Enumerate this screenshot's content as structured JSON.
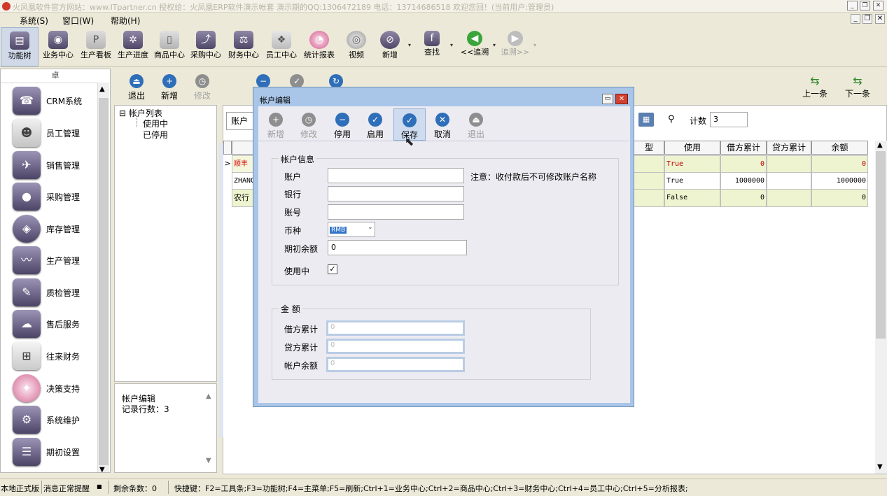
{
  "window": {
    "title": "火凤凰软件官方网站：www.ITpartner.cn 授权给：火凤凰ERP软件演示帐套 演示期的QQ:1306472189 电话：13714686518 欢迎您回！(当前用户:管理员)"
  },
  "menu": {
    "items": [
      "系统(S)",
      "窗口(W)",
      "帮助(H)"
    ]
  },
  "toolbar": {
    "items": [
      {
        "label": "功能树",
        "icon": "tree-icon"
      },
      {
        "label": "业务中心",
        "icon": "business-icon"
      },
      {
        "label": "生产看板",
        "icon": "board-icon"
      },
      {
        "label": "生产进度",
        "icon": "progress-icon"
      },
      {
        "label": "商品中心",
        "icon": "goods-icon"
      },
      {
        "label": "采购中心",
        "icon": "purchase-icon"
      },
      {
        "label": "财务中心",
        "icon": "finance-icon"
      },
      {
        "label": "员工中心",
        "icon": "staff-icon"
      },
      {
        "label": "统计报表",
        "icon": "report-icon"
      },
      {
        "label": "视频",
        "icon": "video-icon"
      },
      {
        "label": "新增",
        "icon": "add-icon"
      },
      {
        "label": "查找",
        "icon": "find-icon"
      },
      {
        "label": "<<追溯",
        "icon": "back-icon"
      },
      {
        "label": "追溯>>",
        "icon": "forward-icon"
      }
    ]
  },
  "sidebar": {
    "header": "卓",
    "modules": [
      "CRM系统",
      "员工管理",
      "销售管理",
      "采购管理",
      "库存管理",
      "生产管理",
      "质检管理",
      "售后服务",
      "往来财务",
      "决策支持",
      "系统维护",
      "期初设置"
    ]
  },
  "right_toolbar": {
    "exit": "退出",
    "new": "新增",
    "edit": "修改",
    "prev": "上一条",
    "next": "下一条"
  },
  "tree": {
    "root": "帐户列表",
    "children": [
      "使用中",
      "已停用"
    ]
  },
  "info": {
    "title": "帐户编辑",
    "count": "记录行数：3"
  },
  "grid": {
    "filter_label": "账户",
    "count_label": "计数",
    "count_value": "3",
    "columns": [
      "型",
      "使用",
      "借方累计",
      "贷方累计",
      "余额"
    ],
    "rows": [
      {
        "name": "顺丰",
        "use": "True",
        "debit": "0",
        "credit": "",
        "balance": "0"
      },
      {
        "name": "ZHANG",
        "use": "True",
        "debit": "1000000",
        "credit": "",
        "balance": "1000000"
      },
      {
        "name": "农行",
        "use": "False",
        "debit": "0",
        "credit": "",
        "balance": "0"
      }
    ]
  },
  "dialog": {
    "title": "帐户编辑",
    "toolbar": [
      "新增",
      "修改",
      "停用",
      "启用",
      "保存",
      "取消",
      "退出"
    ],
    "group1": "帐户信息",
    "account_label": "账户",
    "bank_label": "银行",
    "accno_label": "账号",
    "currency_label": "币种",
    "currency_value": "RMB",
    "opening_label": "期初余额",
    "opening_value": "0",
    "inuse_label": "使用中",
    "note": "注意：收付款后不可修改账户名称",
    "group2": "金 额",
    "debit_label": "借方累计",
    "credit_label": "贷方累计",
    "balance_label": "帐户余额",
    "debit_value": "0",
    "credit_value": "0",
    "balance_value": "0"
  },
  "status": {
    "edition": "本地正式版",
    "msg": "消息正常提醒",
    "remain": "剩余条数：0",
    "shortcuts": "快捷键：F2=工具条;F3=功能树;F4=主菜单;F5=刷新;Ctrl+1=业务中心;Ctrl+2=商品中心;Ctrl+3=财务中心;Ctrl+4=员工中心;Ctrl+5=分析报表;"
  }
}
